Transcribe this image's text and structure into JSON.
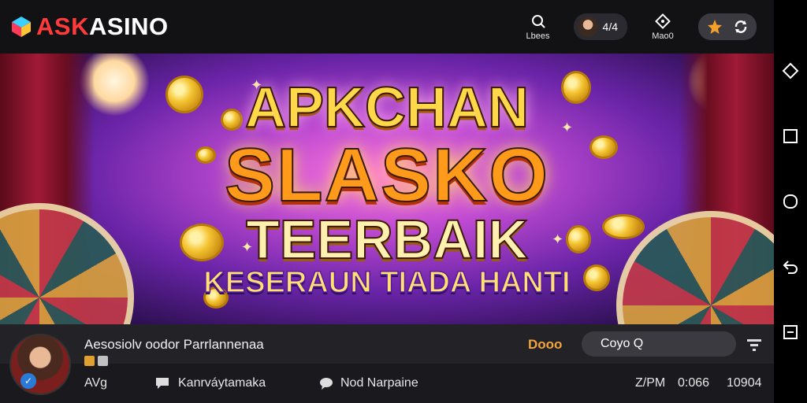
{
  "header": {
    "brand": {
      "part1": "ASK",
      "part2": "ASINO"
    },
    "nav_left_label": "Lbees",
    "user_value": "4/4",
    "nav_right_label": "Mao0"
  },
  "banner": {
    "line1": "APKCHAN",
    "line2": "SLASKO",
    "line3": "TEERBAIK",
    "line4": "KESERAUN TIADA HANTI"
  },
  "info": {
    "title": "Aesosiolv oodor Parrlannenaa",
    "demo_label": "Dooo",
    "search_value": "Coyo Q",
    "row2_left": "AVg",
    "row2_item1": "Kanrváytamaka",
    "row2_item2": "Nod Narpaine",
    "stat1": "Z/PM",
    "stat2": "0:066",
    "stat3": "10904"
  },
  "colors": {
    "accent_red": "#ff3a3a",
    "accent_orange": "#f2a33a",
    "background": "#121214"
  }
}
